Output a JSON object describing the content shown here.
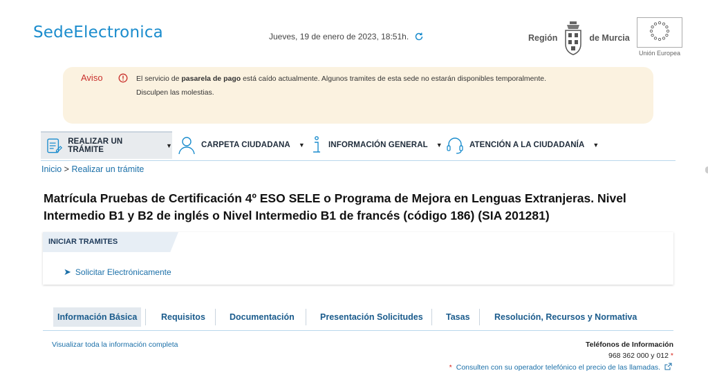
{
  "header": {
    "logo_text": "SedeElectronica",
    "datetime": "Jueves, 19 de enero de 2023, 18:51h.",
    "region_left": "Región",
    "region_right": "de Murcia",
    "eu_label": "Unión Europea"
  },
  "notice": {
    "title": "Aviso",
    "text1_pre": "El servicio de ",
    "text1_bold": "pasarela de pago",
    "text1_post": " está caído actualmente. Algunos tramites de esta sede no estarán disponibles temporalmente.",
    "text2": "Disculpen las molestias."
  },
  "nav": {
    "items": [
      {
        "label": "REALIZAR UN TRÁMITE"
      },
      {
        "label": "CARPETA CIUDADANA"
      },
      {
        "label": "INFORMACIÓN GENERAL"
      },
      {
        "label": "ATENCIÓN A LA CIUDADANÍA"
      }
    ]
  },
  "breadcrumb": {
    "home": "Inicio",
    "separator": ">",
    "current": "Realizar un trámite"
  },
  "page": {
    "title": "Matrícula Pruebas de Certificación 4º ESO SELE o Programa de Mejora en Lenguas Extranjeras. Nivel Intermedio B1 y B2 de inglés o Nivel Intermedio B1 de francés (código 186) (SIA 201281)"
  },
  "card": {
    "header": "INICIAR TRAMITES",
    "action": "Solicitar Electrónicamente"
  },
  "tabs": {
    "items": [
      {
        "label": "Información Básica"
      },
      {
        "label": "Requisitos"
      },
      {
        "label": "Documentación"
      },
      {
        "label": "Presentación Solicitudes"
      },
      {
        "label": "Tasas"
      },
      {
        "label": "Resolución, Recursos y Normativa"
      }
    ]
  },
  "info": {
    "full_link": "Visualizar toda la información completa",
    "phones_title": "Teléfonos de Información",
    "phones_numbers": "968 362 000 y 012",
    "asterisk": "*",
    "note": "Consulten con su operador telefónico el precio de las llamadas."
  },
  "colors": {
    "brand": "#1a8ccd",
    "link": "#1a6fa8",
    "notice_bg": "#fbf2e0",
    "notice_title": "#c9302c"
  }
}
